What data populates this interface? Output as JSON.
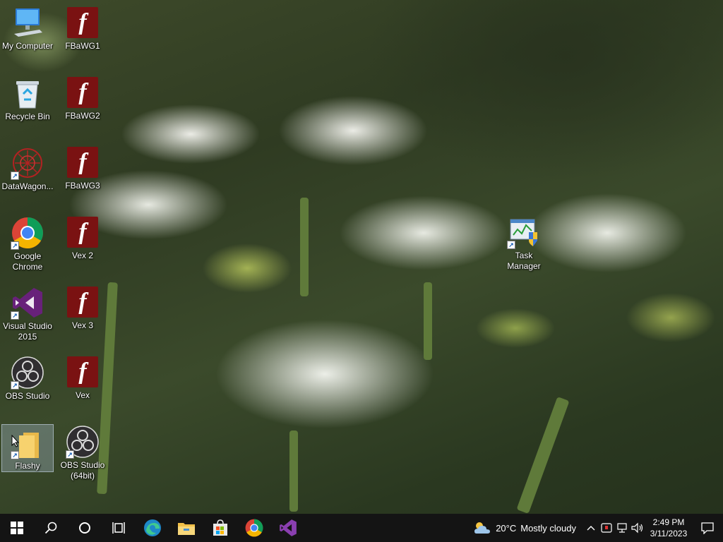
{
  "desktop": {
    "icons": [
      {
        "label": "My Computer",
        "icon": "computer-icon"
      },
      {
        "label": "Recycle Bin",
        "icon": "recycle-bin-icon"
      },
      {
        "label": "DataWagon...",
        "icon": "datawagon-icon"
      },
      {
        "label": "Google Chrome",
        "icon": "chrome-icon"
      },
      {
        "label": "Visual Studio 2015",
        "icon": "visual-studio-icon"
      },
      {
        "label": "OBS Studio",
        "icon": "obs-icon"
      },
      {
        "label": "Flashy",
        "icon": "folder-icon"
      },
      {
        "label": "FBaWG1",
        "icon": "flash-icon"
      },
      {
        "label": "FBaWG2",
        "icon": "flash-icon"
      },
      {
        "label": "FBaWG3",
        "icon": "flash-icon"
      },
      {
        "label": "Vex 2",
        "icon": "flash-icon"
      },
      {
        "label": "Vex 3",
        "icon": "flash-icon"
      },
      {
        "label": "Vex",
        "icon": "flash-icon"
      },
      {
        "label": "OBS Studio (64bit)",
        "icon": "obs-icon"
      },
      {
        "label": "Task Manager",
        "icon": "task-manager-icon"
      }
    ]
  },
  "taskbar": {
    "pinned": [
      "windows-start-icon",
      "search-icon",
      "cortana-icon",
      "task-view-icon",
      "edge-icon",
      "file-explorer-icon",
      "microsoft-store-icon",
      "chrome-icon",
      "visual-studio-icon"
    ],
    "weather": {
      "temperature": "20°C",
      "condition": "Mostly cloudy"
    },
    "clock": {
      "time": "2:49 PM",
      "date": "3/11/2023"
    }
  },
  "colors": {
    "taskbar_bg": "#141414",
    "flash_red": "#7a1212",
    "vs_purple": "#68217a",
    "selection": "#aabed2"
  }
}
